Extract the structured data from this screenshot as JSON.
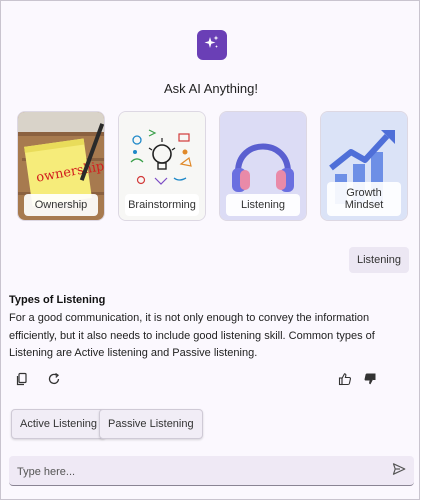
{
  "header": {
    "logo_icon": "sparkle-icon",
    "title": "Ask AI Anything!"
  },
  "suggestions": [
    {
      "label": "Ownership",
      "image": "ownership-note-image"
    },
    {
      "label": "Brainstorming",
      "image": "brainstorming-doodle-image"
    },
    {
      "label": "Listening",
      "image": "headphones-image"
    },
    {
      "label": "Growth Mindset",
      "image": "growth-chart-image"
    }
  ],
  "conversation": {
    "user_message": "Listening",
    "response_title": "Types of Listening",
    "response_text": "For a good communication, it is not only enough to convey the information efficiently, but it also needs to include good listening skill. Common types of Listening are Active listening and Passive listening."
  },
  "actions": {
    "copy_icon": "copy-icon",
    "refresh_icon": "refresh-icon",
    "like_icon": "thumbs-up-icon",
    "dislike_icon": "thumbs-down-icon"
  },
  "followups": [
    "Active Listening",
    "Passive Listening"
  ],
  "input": {
    "placeholder": "Type here...",
    "value": "",
    "send_icon": "send-icon"
  },
  "colors": {
    "accent": "#6a3fb6",
    "background": "#fbf8fe",
    "chip_bg": "#f1edf6",
    "input_bg": "#efe9f5"
  }
}
